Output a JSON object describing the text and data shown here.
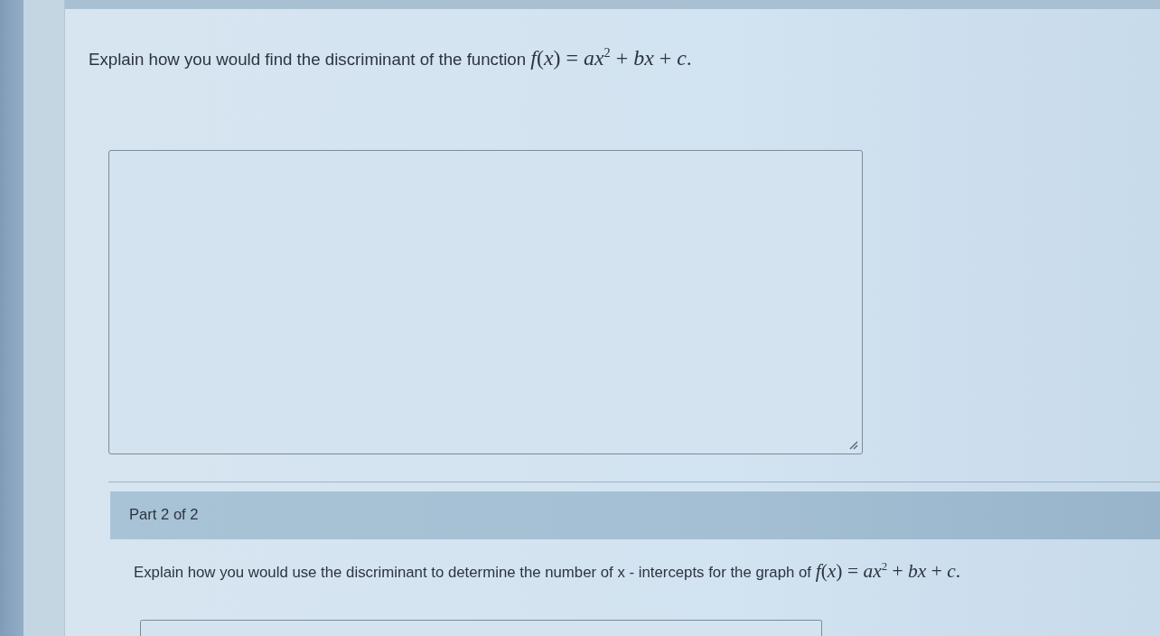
{
  "parts": [
    {
      "question": {
        "text": "Explain how you would find the discriminant of the function",
        "formula": "*f*(*x*) = *ax*$^{2}$ + *bx* + *c*."
      },
      "answer": {
        "resize_handle": true
      }
    },
    {
      "header": "Part 2 of 2",
      "question": {
        "text": "Explain how you would use the discriminant to determine the number of x - intercepts for the graph of",
        "formula": "*f*(*x*) = *ax*$^{2}$ + *bx* + *c*."
      }
    }
  ]
}
